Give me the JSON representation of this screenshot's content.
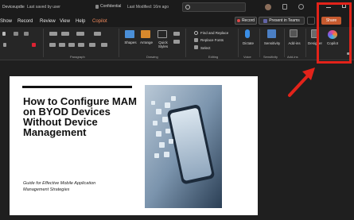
{
  "titlebar": {
    "doc_name": "Deviceupdte",
    "saved": "Last saved by user",
    "confidential": "Confidential",
    "modified": "Last Modified: 16m ago",
    "search_placeholder": ""
  },
  "menu": [
    "Show",
    "Record",
    "Review",
    "View",
    "Help",
    "Copilot"
  ],
  "actions": {
    "record": "Record",
    "present_teams": "Present in Teams",
    "share": "Share"
  },
  "ribbon": {
    "groups": {
      "paragraph": "Paragraph",
      "drawing": "Drawing",
      "editing": "Editing",
      "voice": "Voice",
      "sensitivity": "Sensitivity",
      "addins": "Add-ins"
    },
    "buttons": {
      "shapes": "Shapes",
      "arrange": "Arrange",
      "quick_styles": "Quick Styles",
      "find_replace": "Find and Replace",
      "replace_fonts": "Replace Fonts",
      "select": "Select",
      "dictate": "Dictate",
      "sensitivity": "Sensitivity",
      "addins": "Add-ins",
      "designer": "Designer",
      "copilot": "Copilot"
    }
  },
  "slide": {
    "title": "How to Configure MAM on BYOD Devices Without Device Management",
    "subtitle": "Guide for Effective Mobile Application Management Strategies"
  },
  "colors": {
    "share": "#c65a2f",
    "copilot_menu": "#f08a5d",
    "highlight": "#e2231a"
  }
}
